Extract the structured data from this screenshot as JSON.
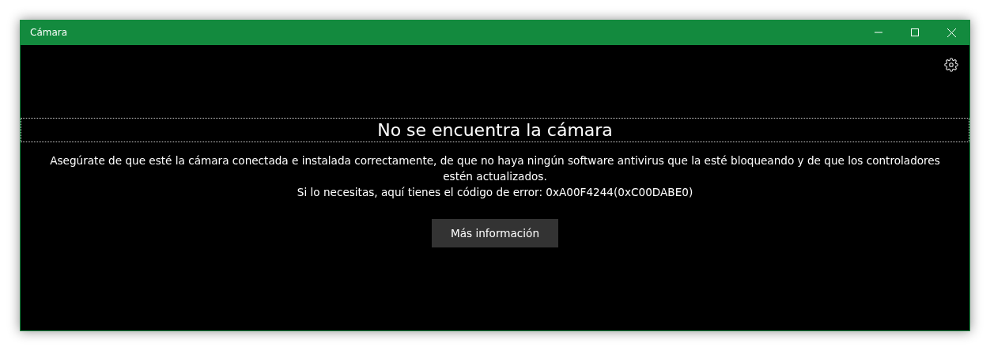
{
  "window": {
    "title": "Cámara"
  },
  "error": {
    "title": "No se encuentra la cámara",
    "message": "Asegúrate de que esté la cámara conectada e instalada correctamente, de que no haya ningún software antivirus que la esté bloqueando y de que los controladores estén actualizados.",
    "code_line": "Si lo necesitas, aquí tienes el código de error: 0xA00F4244(0xC00DABE0)"
  },
  "buttons": [
    "Más información"
  ]
}
